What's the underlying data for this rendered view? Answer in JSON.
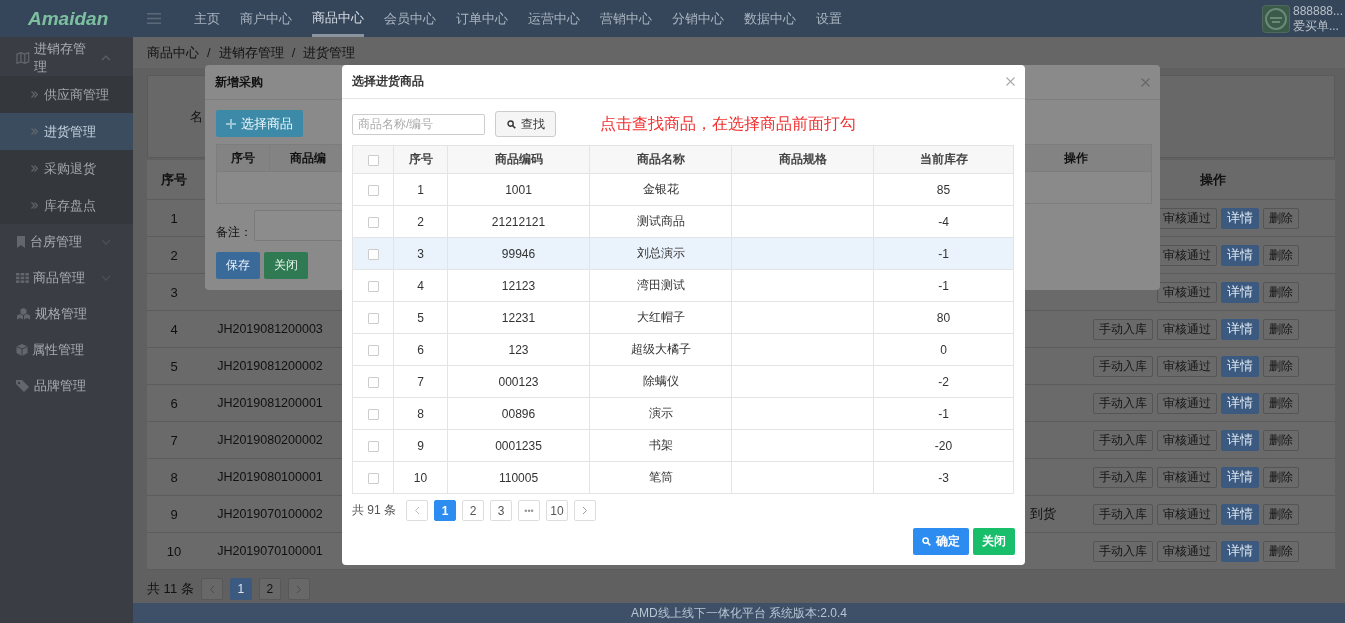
{
  "top_nav": {
    "logo": "Amaidan",
    "menu": [
      {
        "label": "主页",
        "selected": false
      },
      {
        "label": "商户中心",
        "selected": false
      },
      {
        "label": "商品中心",
        "selected": true
      },
      {
        "label": "会员中心",
        "selected": false
      },
      {
        "label": "订单中心",
        "selected": false
      },
      {
        "label": "运营中心",
        "selected": false
      },
      {
        "label": "营销中心",
        "selected": false
      },
      {
        "label": "分销中心",
        "selected": false
      },
      {
        "label": "数据中心",
        "selected": false
      },
      {
        "label": "设置",
        "selected": false
      }
    ],
    "user": {
      "account": "888888...",
      "shop": "爱买单..."
    }
  },
  "sidebar": {
    "items": [
      {
        "label": "进销存管理",
        "expanded": true,
        "children": [
          {
            "label": "供应商管理",
            "selected": false
          },
          {
            "label": "进货管理",
            "selected": true
          },
          {
            "label": "采购退货",
            "selected": false
          },
          {
            "label": "库存盘点",
            "selected": false
          }
        ]
      },
      {
        "label": "台房管理",
        "expanded": false
      },
      {
        "label": "商品管理",
        "expanded": false
      },
      {
        "label": "规格管理"
      },
      {
        "label": "属性管理"
      },
      {
        "label": "品牌管理"
      }
    ]
  },
  "breadcrumb": {
    "separator": "/",
    "items": [
      "商品中心",
      "进销存管理",
      "进货管理"
    ]
  },
  "search_panel": {
    "label": "名"
  },
  "orders_table": {
    "columns": {
      "index": "序号",
      "actions": "操作"
    },
    "rows": [
      {
        "index": "1",
        "actions": [
          {
            "label": "审核通过",
            "kind": "default"
          },
          {
            "label": "详情",
            "kind": "primary"
          },
          {
            "label": "删除",
            "kind": "default"
          }
        ]
      },
      {
        "index": "2",
        "actions": [
          {
            "label": "审核通过",
            "kind": "default"
          },
          {
            "label": "详情",
            "kind": "primary"
          },
          {
            "label": "删除",
            "kind": "default"
          }
        ]
      },
      {
        "index": "3",
        "actions": [
          {
            "label": "审核通过",
            "kind": "default"
          },
          {
            "label": "详情",
            "kind": "primary"
          },
          {
            "label": "删除",
            "kind": "default"
          }
        ]
      },
      {
        "index": "4",
        "code": "JH2019081200003",
        "actions": [
          {
            "label": "手动入库",
            "kind": "default"
          },
          {
            "label": "审核通过",
            "kind": "default"
          },
          {
            "label": "详情",
            "kind": "primary"
          },
          {
            "label": "删除",
            "kind": "default"
          }
        ]
      },
      {
        "index": "5",
        "code": "JH2019081200002",
        "actions": [
          {
            "label": "手动入库",
            "kind": "default"
          },
          {
            "label": "审核通过",
            "kind": "default"
          },
          {
            "label": "详情",
            "kind": "primary"
          },
          {
            "label": "删除",
            "kind": "default"
          }
        ]
      },
      {
        "index": "6",
        "code": "JH2019081200001",
        "actions": [
          {
            "label": "手动入库",
            "kind": "default"
          },
          {
            "label": "审核通过",
            "kind": "default"
          },
          {
            "label": "详情",
            "kind": "primary"
          },
          {
            "label": "删除",
            "kind": "default"
          }
        ]
      },
      {
        "index": "7",
        "code": "JH2019080200002",
        "actions": [
          {
            "label": "手动入库",
            "kind": "default"
          },
          {
            "label": "审核通过",
            "kind": "default"
          },
          {
            "label": "详情",
            "kind": "primary"
          },
          {
            "label": "删除",
            "kind": "default"
          }
        ]
      },
      {
        "index": "8",
        "code": "JH2019080100001",
        "actions": [
          {
            "label": "手动入库",
            "kind": "default"
          },
          {
            "label": "审核通过",
            "kind": "default"
          },
          {
            "label": "详情",
            "kind": "primary"
          },
          {
            "label": "删除",
            "kind": "default"
          }
        ]
      },
      {
        "index": "9",
        "code": "JH2019070100002",
        "status": "到货",
        "actions": [
          {
            "label": "手动入库",
            "kind": "default"
          },
          {
            "label": "审核通过",
            "kind": "default"
          },
          {
            "label": "详情",
            "kind": "primary"
          },
          {
            "label": "删除",
            "kind": "default"
          }
        ]
      },
      {
        "index": "10",
        "code": "JH2019070100001",
        "actions": [
          {
            "label": "手动入库",
            "kind": "default"
          },
          {
            "label": "审核通过",
            "kind": "default"
          },
          {
            "label": "详情",
            "kind": "primary"
          },
          {
            "label": "删除",
            "kind": "default"
          }
        ]
      }
    ],
    "pagination": {
      "total": "共 11 条",
      "pages": [
        {
          "label": "1",
          "selected": true
        },
        {
          "label": "2",
          "selected": false
        }
      ]
    }
  },
  "footer": "AMD线上线下一体化平台 系统版本:2.0.4",
  "purchase_dialog": {
    "title": "新增采购",
    "add_button": "选择商品",
    "columns": [
      "序号",
      "商品编"
    ],
    "actions_column": "操作",
    "remark_label": "备注：",
    "buttons": [
      {
        "label": "保存",
        "kind": "primary"
      },
      {
        "label": "关闭",
        "kind": "success"
      }
    ]
  },
  "select_dialog": {
    "title": "选择进货商品",
    "search": {
      "placeholder": "商品名称/编号",
      "button": "查找"
    },
    "hint": "点击查找商品，在选择商品前面打勾",
    "table": {
      "all_checked": false,
      "columns": [
        "序号",
        "商品编码",
        "商品名称",
        "商品规格",
        "当前库存"
      ],
      "rows": [
        {
          "checked": false,
          "highlighted": false,
          "index": "1",
          "code": "1001",
          "name": "金银花",
          "stock": "85"
        },
        {
          "checked": false,
          "highlighted": false,
          "index": "2",
          "code": "21212121",
          "name": "测试商品",
          "stock": "-4"
        },
        {
          "checked": false,
          "highlighted": true,
          "index": "3",
          "code": "99946",
          "name": "刘总演示",
          "stock": "-1"
        },
        {
          "checked": false,
          "highlighted": false,
          "index": "4",
          "code": "12123",
          "name": "湾田测试",
          "stock": "-1"
        },
        {
          "checked": false,
          "highlighted": false,
          "index": "5",
          "code": "12231",
          "name": "大红帽子",
          "stock": "80"
        },
        {
          "checked": false,
          "highlighted": false,
          "index": "6",
          "code": "123",
          "name": "超级大橘子",
          "stock": "0"
        },
        {
          "checked": false,
          "highlighted": false,
          "index": "7",
          "code": "000123",
          "name": "除螨仪",
          "stock": "-2"
        },
        {
          "checked": false,
          "highlighted": false,
          "index": "8",
          "code": "00896",
          "name": "演示",
          "stock": "-1"
        },
        {
          "checked": false,
          "highlighted": false,
          "index": "9",
          "code": "0001235",
          "name": "书架",
          "stock": "-20"
        },
        {
          "checked": false,
          "highlighted": false,
          "index": "10",
          "code": "110005",
          "name": "笔筒",
          "stock": "-3"
        }
      ]
    },
    "pagination": {
      "total": "共 91 条",
      "pages": [
        {
          "label": "1",
          "selected": true
        },
        {
          "label": "2",
          "selected": false
        },
        {
          "label": "3",
          "selected": false
        }
      ],
      "ellipsis": "•••",
      "last_page": {
        "label": "10",
        "selected": false
      }
    },
    "buttons": [
      {
        "label": "确定",
        "kind": "primary"
      },
      {
        "label": "关闭",
        "kind": "success"
      }
    ]
  }
}
